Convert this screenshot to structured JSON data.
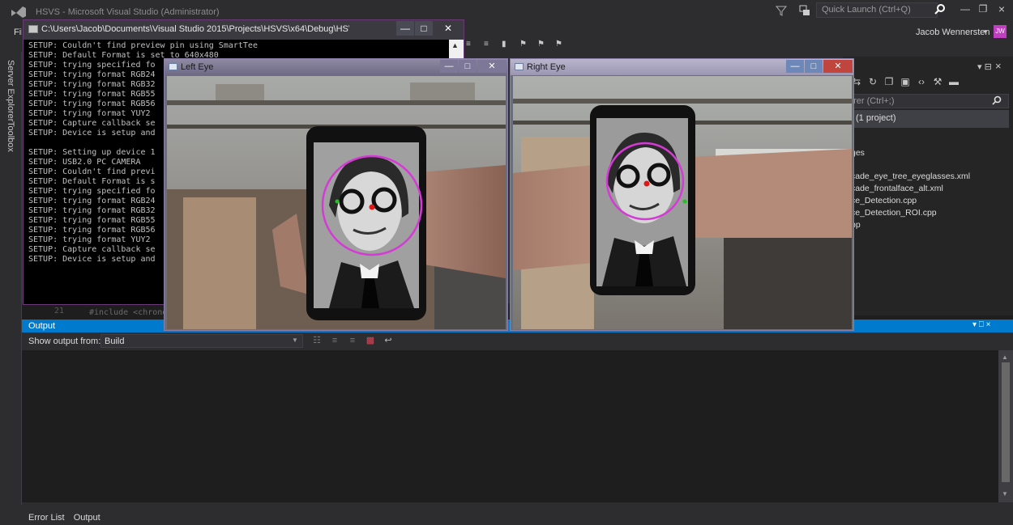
{
  "vs": {
    "title": "HSVS - Microsoft Visual Studio (Administrator)",
    "quick_launch_placeholder": "Quick Launch (Ctrl+Q)",
    "user_name": "Jacob Wennersten",
    "user_initials": "JW",
    "menu_file": "File",
    "left_tabs": [
      "Server Explorer",
      "Toolbox"
    ]
  },
  "editor": {
    "line_number": "21",
    "code_fragment": "#include <chrono>"
  },
  "console": {
    "path": "C:\\Users\\Jacob\\Documents\\Visual Studio 2015\\Projects\\HSVS\\x64\\Debug\\HSVS.exe",
    "lines": "SETUP: Couldn't find preview pin using SmartTee\nSETUP: Default Format is set to 640x480\nSETUP: trying specified fo\nSETUP: trying format RGB24\nSETUP: trying format RGB32\nSETUP: trying format RGB55\nSETUP: trying format RGB56\nSETUP: trying format YUY2\nSETUP: Capture callback se\nSETUP: Device is setup and\n\nSETUP: Setting up device 1\nSETUP: USB2.0 PC CAMERA\nSETUP: Couldn't find previ\nSETUP: Default Format is s\nSETUP: trying specified fo\nSETUP: trying format RGB24\nSETUP: trying format RGB32\nSETUP: trying format RGB55\nSETUP: trying format RGB56\nSETUP: trying format YUY2\nSETUP: Capture callback se\nSETUP: Device is setup and"
  },
  "left_eye": {
    "title": "Left Eye"
  },
  "right_eye": {
    "title": "Right Eye"
  },
  "solution_explorer": {
    "search_placeholder": "orer (Ctrl+;)",
    "solution_label": "(1 project)",
    "items": [
      "ges",
      "cade_eye_tree_eyeglasses.xml",
      "cade_frontalface_alt.xml",
      "ce_Detection.cpp",
      "ce_Detection_ROI.cpp",
      "pp"
    ]
  },
  "output": {
    "title": "Output",
    "show_from_label": "Show output from:",
    "source": "Build",
    "bottom_tabs": [
      "Error List",
      "Output"
    ]
  },
  "colors": {
    "vs_background": "#2d2d30",
    "output_header": "#007acc",
    "face_circle": "#d63ad6",
    "center_dot": "#e01818",
    "edge_dot": "#22c022"
  }
}
